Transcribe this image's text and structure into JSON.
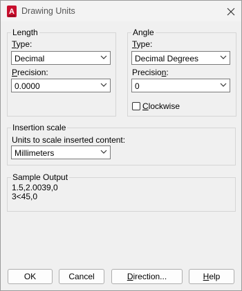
{
  "window": {
    "title": "Drawing Units"
  },
  "length": {
    "group_label": "Length",
    "type_label": "Type:",
    "type_value": "Decimal",
    "precision_label": "Precision:",
    "precision_value": "0.0000"
  },
  "angle": {
    "group_label": "Angle",
    "type_label": "Type:",
    "type_value": "Decimal Degrees",
    "precision_label": "Precision:",
    "precision_value": "0",
    "clockwise_label": "Clockwise",
    "clockwise_checked": false
  },
  "insertion": {
    "group_label": "Insertion scale",
    "units_label": "Units to scale inserted content:",
    "units_value": "Millimeters"
  },
  "sample": {
    "group_label": "Sample Output",
    "line1": "1.5,2.0039,0",
    "line2": "3<45,0"
  },
  "buttons": {
    "ok": "OK",
    "cancel": "Cancel",
    "direction": "Direction...",
    "help": "Help"
  },
  "icons": {
    "app": "autocad-a-icon",
    "close": "close-icon",
    "dropdown": "chevron-down-icon"
  }
}
